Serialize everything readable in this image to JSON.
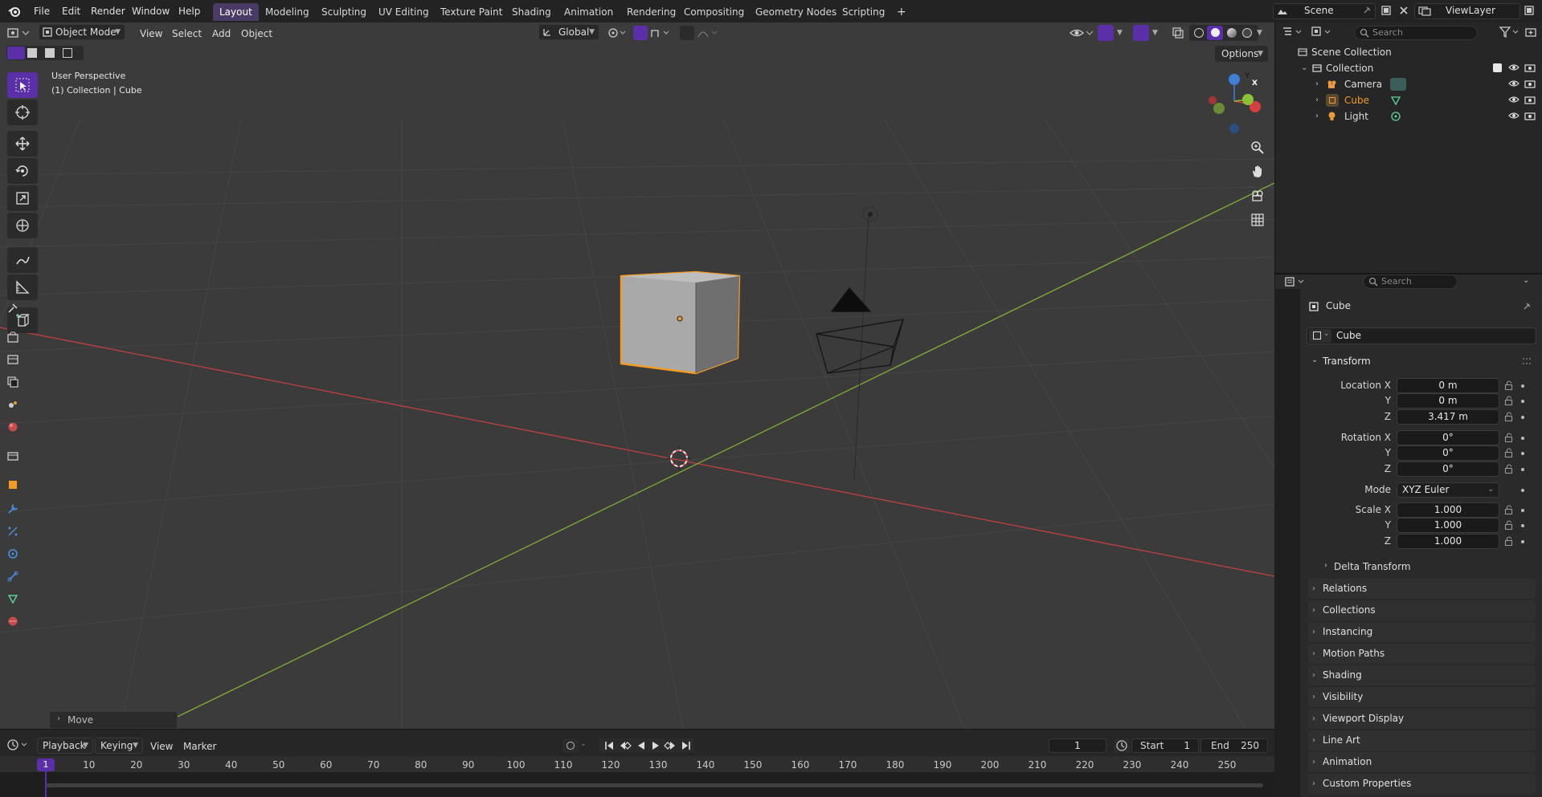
{
  "topbar": {
    "menus": [
      "File",
      "Edit",
      "Render",
      "Window",
      "Help"
    ],
    "workspaces": [
      "Layout",
      "Modeling",
      "Sculpting",
      "UV Editing",
      "Texture Paint",
      "Shading",
      "Animation",
      "Rendering",
      "Compositing",
      "Geometry Nodes",
      "Scripting"
    ],
    "active_workspace": "Layout",
    "add_tab": "+",
    "scene_name": "Scene",
    "view_layer": "ViewLayer"
  },
  "viewport_header": {
    "mode": "Object Mode",
    "menus": [
      "View",
      "Select",
      "Add",
      "Object"
    ],
    "transform_orientation": "Global",
    "options_label": "Options"
  },
  "viewport": {
    "perspective": "User Perspective",
    "collection_info": "(1) Collection | Cube",
    "last_operator": "Move",
    "gizmo_axes": {
      "x": "X",
      "y": "Y",
      "z": "Z"
    },
    "colors": {
      "selected_outline": "#f39b24",
      "x_axis": "#c24040",
      "y_axis": "#7fa832",
      "accent": "#5a2fa8"
    }
  },
  "outliner": {
    "search_placeholder": "Search",
    "root": "Scene Collection",
    "collection": "Collection",
    "objects": [
      {
        "name": "Camera",
        "icon": "camera-icon",
        "selected": false
      },
      {
        "name": "Cube",
        "icon": "mesh-icon",
        "selected": true
      },
      {
        "name": "Light",
        "icon": "light-icon",
        "selected": false
      }
    ]
  },
  "properties": {
    "search_placeholder": "Search",
    "object_name": "Cube",
    "datablock_name": "Cube",
    "transform_label": "Transform",
    "location": {
      "label": "Location X",
      "y_label": "Y",
      "z_label": "Z",
      "x": "0 m",
      "y": "0 m",
      "z": "3.417 m"
    },
    "rotation": {
      "label": "Rotation X",
      "y_label": "Y",
      "z_label": "Z",
      "x": "0°",
      "y": "0°",
      "z": "0°"
    },
    "mode": {
      "label": "Mode",
      "value": "XYZ Euler"
    },
    "scale": {
      "label": "Scale X",
      "y_label": "Y",
      "z_label": "Z",
      "x": "1.000",
      "y": "1.000",
      "z": "1.000"
    },
    "delta_transform": "Delta Transform",
    "panels": [
      "Relations",
      "Collections",
      "Instancing",
      "Motion Paths",
      "Shading",
      "Visibility",
      "Viewport Display",
      "Line Art",
      "Animation",
      "Custom Properties"
    ]
  },
  "timeline": {
    "menus": [
      "Playback",
      "Keying",
      "View",
      "Marker"
    ],
    "current_frame": "1",
    "start_label": "Start",
    "start": "1",
    "end_label": "End",
    "end": "250",
    "ruler": [
      "1",
      "10",
      "20",
      "30",
      "40",
      "50",
      "60",
      "70",
      "80",
      "90",
      "100",
      "110",
      "120",
      "130",
      "140",
      "150",
      "160",
      "170",
      "180",
      "190",
      "200",
      "210",
      "220",
      "230",
      "240",
      "250"
    ]
  }
}
